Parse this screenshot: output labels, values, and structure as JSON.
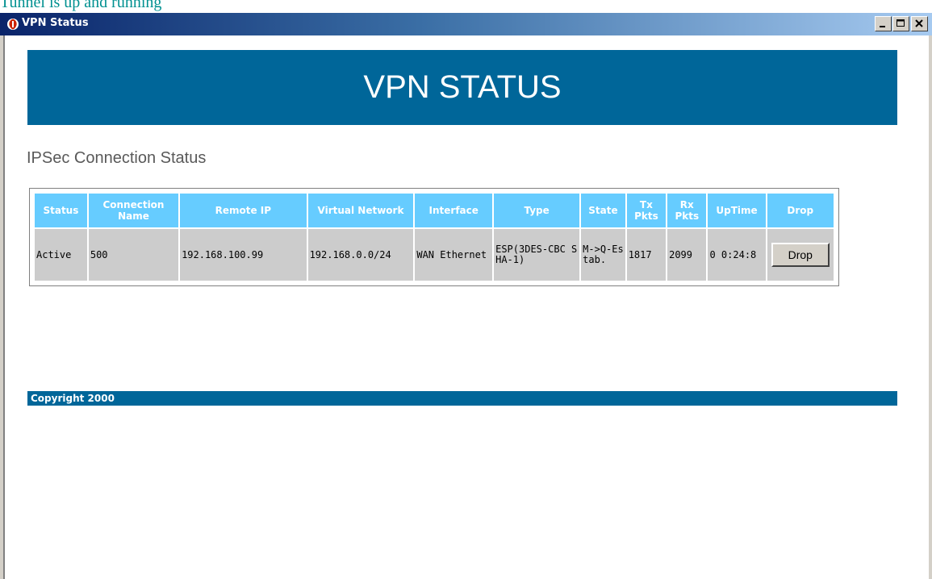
{
  "page_caption": "Tunnel is up and running",
  "window": {
    "title": "VPN Status",
    "icon": "vpn-shield-icon",
    "title_gradient": [
      "#0a246a",
      "#a6caf0"
    ]
  },
  "banner": {
    "title": "VPN STATUS",
    "background": "#006699"
  },
  "section_title": "IPSec Connection Status",
  "table": {
    "header_color": "#66ccff",
    "cell_color": "#cccccc",
    "headers": [
      "Status",
      "Connection Name",
      "Remote IP",
      "Virtual Network",
      "Interface",
      "Type",
      "State",
      "Tx Pkts",
      "Rx Pkts",
      "UpTime",
      "Drop"
    ],
    "rows": [
      {
        "status": "Active",
        "connection_name": "500",
        "remote_ip": "192.168.100.99",
        "virtual_network": "192.168.0.0/24",
        "interface": "WAN Ethernet",
        "type": "ESP(3DES-CBC SHA-1)",
        "state": "M->Q-Estab.",
        "tx_pkts": "1817",
        "rx_pkts": "2099",
        "uptime": "0 0:24:8",
        "drop_label": "Drop"
      }
    ]
  },
  "footer": {
    "text": "Copyright 2000"
  }
}
